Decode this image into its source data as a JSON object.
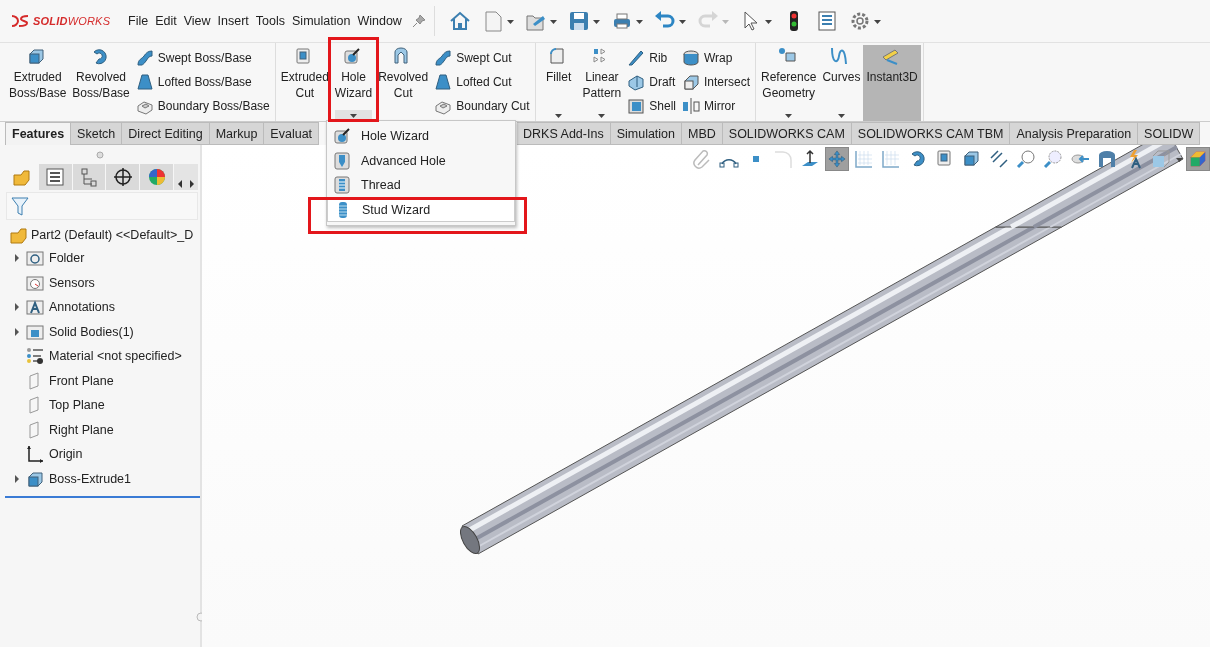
{
  "app": {
    "logo": "**SOLID**WORKS"
  },
  "menu": [
    "File",
    "Edit",
    "View",
    "Insert",
    "Tools",
    "Simulation",
    "Window"
  ],
  "quick_access": [
    {
      "dropdown": false,
      "disabled": false
    },
    {
      "dropdown": true,
      "disabled": false
    },
    {
      "dropdown": true,
      "disabled": false
    },
    {
      "dropdown": true,
      "disabled": false
    },
    {
      "dropdown": true,
      "disabled": false
    },
    {
      "dropdown": true,
      "disabled": false
    },
    {
      "dropdown": true,
      "disabled": true
    },
    {
      "dropdown": true,
      "disabled": false
    },
    {
      "dropdown": false,
      "disabled": false
    },
    {
      "dropdown": false,
      "disabled": false
    },
    {
      "dropdown": true,
      "disabled": false
    }
  ],
  "ribbon": [
    {
      "items": [
        {
          "kind": "large",
          "label": "Extruded Boss/Base",
          "dropdown": false,
          "pressed": false,
          "outlined": false
        },
        {
          "kind": "large",
          "label": "Revolved Boss/Base",
          "dropdown": false,
          "pressed": false,
          "outlined": false
        },
        {
          "kind": "stack",
          "items": [
            {
              "label": "Swept Boss/Base"
            },
            {
              "label": "Lofted Boss/Base"
            },
            {
              "label": "Boundary Boss/Base"
            }
          ]
        }
      ]
    },
    {
      "items": [
        {
          "kind": "large",
          "label": "Extruded Cut",
          "dropdown": false,
          "pressed": false,
          "outlined": false
        },
        {
          "kind": "large",
          "label": "Hole Wizard",
          "dropdown": true,
          "pressed": false,
          "outlined": true
        },
        {
          "kind": "large",
          "label": "Revolved Cut",
          "dropdown": false,
          "pressed": false,
          "outlined": false
        },
        {
          "kind": "stack",
          "items": [
            {
              "label": "Swept Cut"
            },
            {
              "label": "Lofted Cut"
            },
            {
              "label": "Boundary Cut"
            }
          ]
        }
      ]
    },
    {
      "items": [
        {
          "kind": "large",
          "label": "Fillet",
          "dropdown": true,
          "pressed": false,
          "outlined": false
        },
        {
          "kind": "large",
          "label": "Linear Pattern",
          "dropdown": true,
          "pressed": false,
          "outlined": false
        },
        {
          "kind": "stack",
          "items": [
            {
              "label": "Rib"
            },
            {
              "label": "Draft"
            },
            {
              "label": "Shell"
            }
          ]
        },
        {
          "kind": "stack",
          "items": [
            {
              "label": "Wrap"
            },
            {
              "label": "Intersect"
            },
            {
              "label": "Mirror"
            }
          ]
        }
      ]
    },
    {
      "items": [
        {
          "kind": "large",
          "label": "Reference Geometry",
          "dropdown": true,
          "pressed": false,
          "outlined": false
        },
        {
          "kind": "large",
          "label": "Curves",
          "dropdown": true,
          "pressed": false,
          "outlined": false
        },
        {
          "kind": "large",
          "label": "Instant3D",
          "dropdown": false,
          "pressed": true,
          "outlined": false
        }
      ]
    }
  ],
  "tabs": [
    {
      "label": "Features",
      "selected": true
    },
    {
      "label": "Sketch",
      "selected": false
    },
    {
      "label": "Direct Editing",
      "selected": false
    },
    {
      "label": "Markup",
      "selected": false
    },
    {
      "label": "Evaluat",
      "selected": false
    },
    {
      "label": "DRKS Add-Ins",
      "selected": false
    },
    {
      "label": "Simulation",
      "selected": false
    },
    {
      "label": "MBD",
      "selected": false
    },
    {
      "label": "SOLIDWORKS CAM",
      "selected": false
    },
    {
      "label": "SOLIDWORKS CAM TBM",
      "selected": false
    },
    {
      "label": "Analysis Preparation",
      "selected": false
    },
    {
      "label": "SOLIDW",
      "selected": false
    }
  ],
  "dropdown_menu": [
    {
      "label": "Hole Wizard",
      "hovered": false,
      "outlined": false
    },
    {
      "label": "Advanced Hole",
      "hovered": false,
      "outlined": false
    },
    {
      "label": "Thread",
      "hovered": false,
      "outlined": false
    },
    {
      "label": "Stud Wizard",
      "hovered": true,
      "outlined": true
    }
  ],
  "panel_tabs": [
    {
      "selected": true
    },
    {
      "selected": false
    },
    {
      "selected": false
    },
    {
      "selected": false
    },
    {
      "selected": false
    }
  ],
  "feature_tree": {
    "root": "Part2 (Default) <<Default>_D",
    "items": [
      {
        "label": "Folder",
        "expandable": true
      },
      {
        "label": "Sensors",
        "expandable": false
      },
      {
        "label": "Annotations",
        "expandable": true
      },
      {
        "label": "Solid Bodies(1)",
        "expandable": true
      },
      {
        "label": "Material <not specified>",
        "expandable": false
      },
      {
        "label": "Front Plane",
        "expandable": false
      },
      {
        "label": "Top Plane",
        "expandable": false
      },
      {
        "label": "Right Plane",
        "expandable": false
      },
      {
        "label": "Origin",
        "expandable": false
      },
      {
        "label": "Boss-Extrude1",
        "expandable": true
      }
    ]
  },
  "view_toolbar": [
    {
      "selected": false
    },
    {
      "selected": false
    },
    {
      "selected": false
    },
    {
      "selected": false
    },
    {
      "selected": false
    },
    {
      "selected": true
    },
    {
      "selected": false
    },
    {
      "selected": false
    },
    {
      "selected": false
    },
    {
      "selected": false
    },
    {
      "selected": false
    },
    {
      "selected": false
    },
    {
      "selected": false
    },
    {
      "selected": false
    },
    {
      "selected": false
    },
    {
      "selected": false
    },
    {
      "selected": false
    },
    {
      "selected": false
    },
    {
      "selected": true
    }
  ]
}
